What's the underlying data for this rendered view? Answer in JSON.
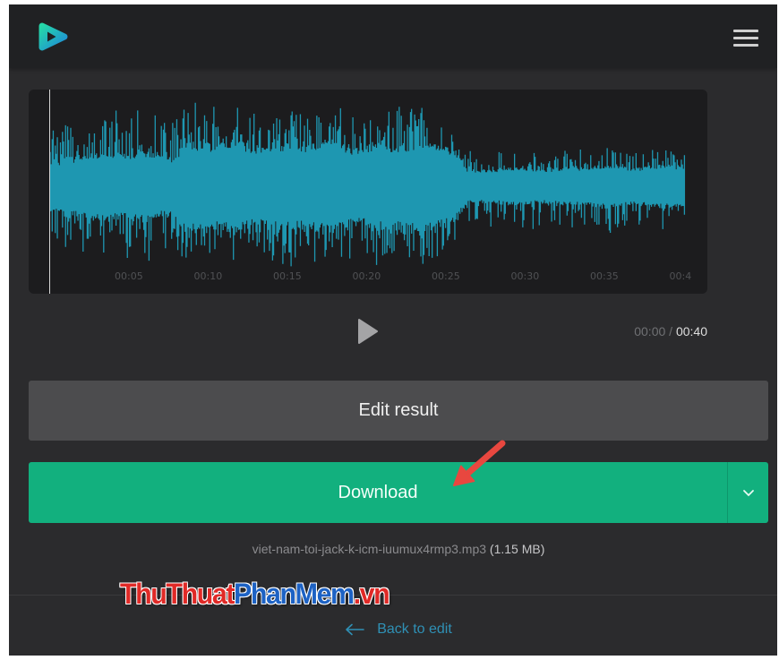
{
  "header": {
    "logo_icon": "logo-icon",
    "menu_icon": "hamburger-menu-icon"
  },
  "player": {
    "timeline_labels": [
      "00:05",
      "00:10",
      "00:15",
      "00:20",
      "00:25",
      "00:30",
      "00:35",
      "00:4"
    ],
    "playback_progress": 0,
    "play_icon": "play-icon",
    "current_time": "00:00",
    "separator": "/",
    "duration": "00:40"
  },
  "actions": {
    "edit_label": "Edit result",
    "download_label": "Download",
    "dropdown_icon": "chevron-down-icon"
  },
  "file": {
    "name": "viet-nam-toi-jack-k-icm-iuumux4rmp3.mp3",
    "size": "(1.15 MB)"
  },
  "footer": {
    "back_icon": "arrow-left-icon",
    "back_label": "Back to edit"
  },
  "watermark": {
    "part1": "ThuThuat",
    "part2": "PhanMem",
    "part3": ".vn"
  },
  "colors": {
    "download": "#12b07e",
    "waveform": "#1e97b1",
    "link": "#2f90b5",
    "annotation": "#e8473f"
  }
}
